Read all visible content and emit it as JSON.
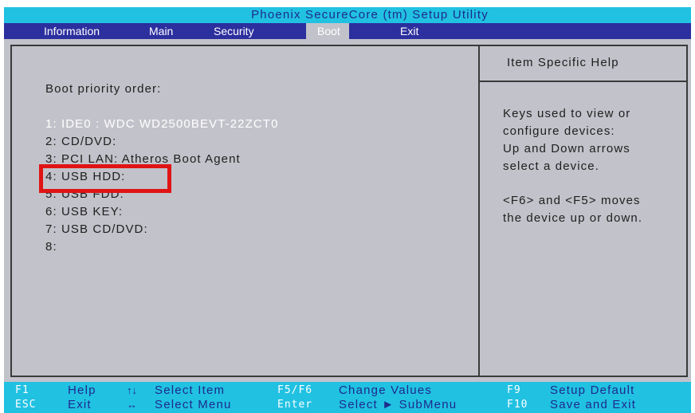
{
  "title": "Phoenix SecureCore (tm) Setup Utility",
  "menu": {
    "items": [
      {
        "label": "Information"
      },
      {
        "label": "Main"
      },
      {
        "label": "Security"
      },
      {
        "label": "Boot"
      },
      {
        "label": "Exit"
      }
    ],
    "active": "Boot"
  },
  "left_panel": {
    "section_label": "Boot priority order:",
    "boot_items": [
      {
        "label": "1: IDE0 : WDC WD2500BEVT-22ZCT0"
      },
      {
        "label": "2: CD/DVD:"
      },
      {
        "label": "3: PCI LAN: Atheros Boot Agent"
      },
      {
        "label": "4: USB HDD:"
      },
      {
        "label": "5: USB FDD:"
      },
      {
        "label": "6: USB KEY:"
      },
      {
        "label": "7: USB CD/DVD:"
      },
      {
        "label": "8:"
      }
    ],
    "selected_index": 0
  },
  "help_panel": {
    "title": "Item Specific Help",
    "lines": [
      "Keys used to view or",
      "configure devices:",
      "Up and Down arrows",
      "select a device.",
      "<F6> and <F5> moves",
      "the device up or down."
    ]
  },
  "footer": {
    "row1": [
      {
        "key": "F1",
        "icon": "",
        "label": "Help"
      },
      {
        "key": "",
        "icon": "↑↓",
        "label": "Select  Item"
      },
      {
        "key": "F5/F6",
        "icon": "",
        "label": "Change  Values"
      },
      {
        "key": "F9",
        "icon": "",
        "label": "Setup  Default"
      }
    ],
    "row2": [
      {
        "key": "ESC",
        "icon": "",
        "label": "Exit"
      },
      {
        "key": "",
        "icon": "↔",
        "label": "Select  Menu"
      },
      {
        "key": "Enter",
        "icon": "",
        "label": "Select ► SubMenu"
      },
      {
        "key": "F10",
        "icon": "",
        "label": "Save  and  Exit"
      }
    ]
  },
  "colors": {
    "title_bar": "#21c1e2",
    "menu_bar": "#2c2f9e",
    "panel_bg": "#c2c2ca",
    "highlight": "#e01414",
    "selected_text": "#ffffff"
  }
}
